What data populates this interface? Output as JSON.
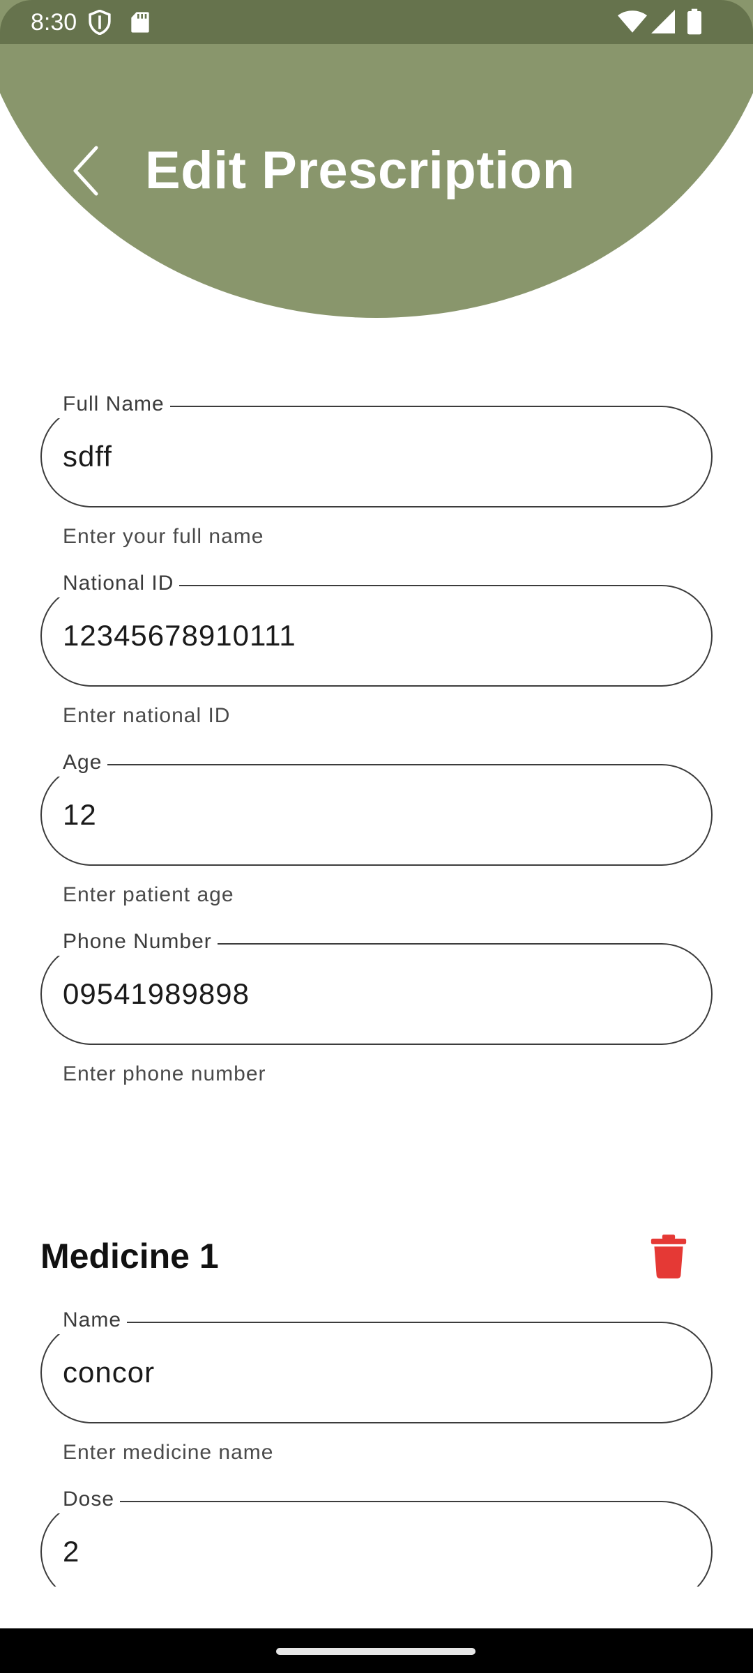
{
  "status_bar": {
    "time": "8:30",
    "icons": [
      "shield-icon",
      "sd-card-icon",
      "wifi-icon",
      "signal-icon",
      "battery-icon"
    ]
  },
  "header": {
    "title": "Edit Prescription",
    "back_icon": "chevron-left-icon",
    "color": "#89966c",
    "status_color": "#66734d"
  },
  "form": {
    "fields": [
      {
        "label": "Full Name",
        "value": "sdff",
        "helper": "Enter your full name"
      },
      {
        "label": "National ID",
        "value": "12345678910111",
        "helper": "Enter national ID"
      },
      {
        "label": "Age",
        "value": "12",
        "helper": "Enter patient age"
      },
      {
        "label": "Phone Number",
        "value": "09541989898",
        "helper": "Enter phone number"
      }
    ]
  },
  "medicine": {
    "title": "Medicine 1",
    "delete_icon": "trash-icon",
    "delete_color": "#e53935",
    "fields": [
      {
        "label": "Name",
        "value": "concor",
        "helper": "Enter medicine name"
      },
      {
        "label": "Dose",
        "value": "2"
      }
    ]
  }
}
